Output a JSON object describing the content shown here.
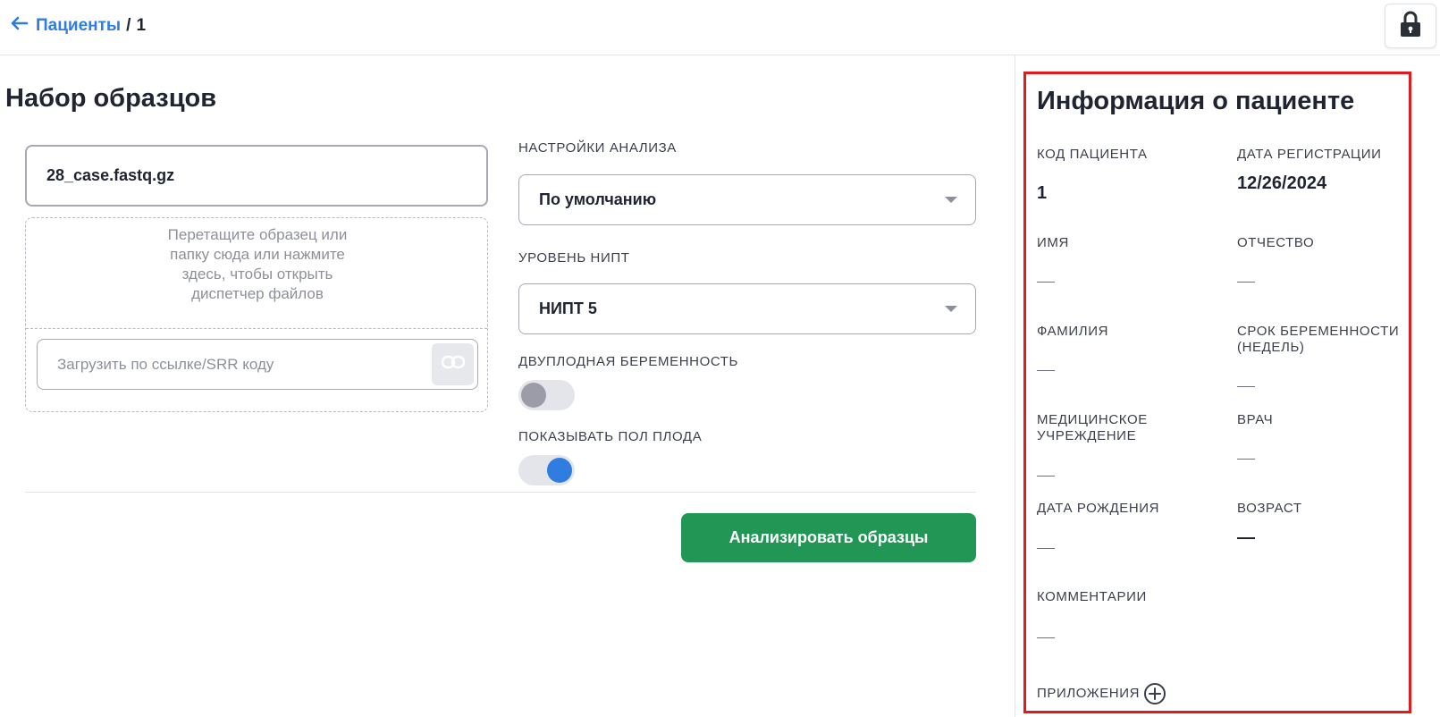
{
  "header": {
    "breadcrumb_link": "Пациенты",
    "breadcrumb_sep": "/",
    "breadcrumb_current": "1"
  },
  "samples": {
    "title": "Набор образцов",
    "file_name": "28_case.fastq.gz",
    "drop_text": "Перетащите образец или папку сюда или нажмите здесь, чтобы открыть диспетчер файлов",
    "url_placeholder": "Загрузить по ссылке/SRR коду"
  },
  "settings": {
    "analysis_label": "НАСТРОЙКИ АНАЛИЗА",
    "analysis_value": "По умолчанию",
    "nipt_label": "УРОВЕНЬ НИПТ",
    "nipt_value": "НИПТ 5",
    "twins_label": "ДВУПЛОДНАЯ БЕРЕМЕННОСТЬ",
    "twins_enabled": false,
    "sex_label": "ПОКАЗЫВАТЬ ПОЛ ПЛОДА",
    "sex_enabled": true
  },
  "actions": {
    "analyze_label": "Анализировать образцы"
  },
  "patient": {
    "title": "Информация о пациенте",
    "code_label": "КОД ПАЦИЕНТА",
    "code_value": "1",
    "reg_date_label": "ДАТА РЕГИСТРАЦИИ",
    "reg_date_value": "12/26/2024",
    "name_label": "ИМЯ",
    "patronymic_label": "ОТЧЕСТВО",
    "surname_label": "ФАМИЛИЯ",
    "term_label": "СРОК БЕРЕМЕННОСТИ (НЕДЕЛЬ)",
    "clinic_label": "МЕДИЦИНСКОЕ УЧРЕЖДЕНИЕ",
    "doctor_label": "ВРАЧ",
    "birth_label": "ДАТА РОЖДЕНИЯ",
    "age_label": "ВОЗРАСТ",
    "comments_label": "КОММЕНТАРИИ",
    "attachments_label": "ПРИЛОЖЕНИЯ"
  },
  "colors": {
    "accent": "#2f7de1",
    "primary_button": "#229655",
    "highlight_border": "#e31a1c"
  },
  "icons": {
    "back": "arrow-left-icon",
    "lock": "lock-icon",
    "link": "link-icon",
    "dropdown": "caret-down-icon",
    "add": "plus-circle-icon"
  }
}
